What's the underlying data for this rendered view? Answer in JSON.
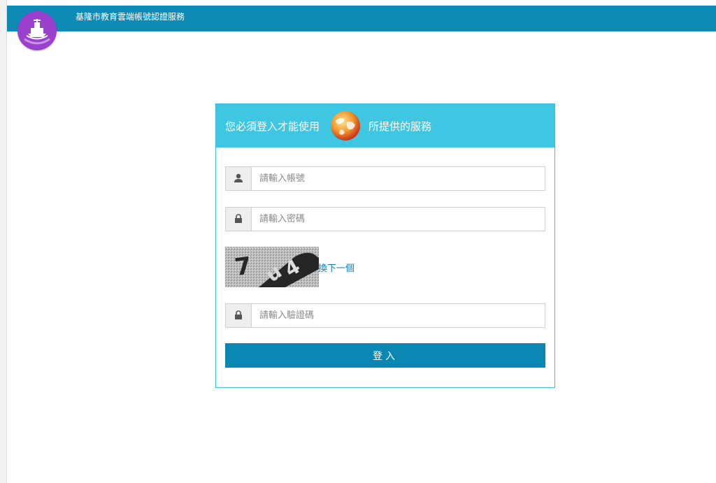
{
  "header": {
    "title": "基隆市教育雲端帳號認證服務",
    "logo_icon": "ship-logo-icon",
    "bar_color": "#0d8bb5"
  },
  "login_card": {
    "header_text_before": "您必須登入才能使用",
    "header_icon": "globe-icon",
    "header_text_after": "所提供的服務",
    "header_color": "#3ec6e2",
    "username": {
      "icon": "user-icon",
      "placeholder": "請輸入帳號",
      "value": ""
    },
    "password": {
      "icon": "lock-icon",
      "placeholder": "請輸入密碼",
      "value": ""
    },
    "captcha": {
      "image_text": "7 u4",
      "refresh_label": "換下一個"
    },
    "captcha_input": {
      "icon": "lock-icon",
      "placeholder": "請輸入驗證碼",
      "value": ""
    },
    "submit_label": "登入",
    "button_color": "#0a87b3"
  }
}
